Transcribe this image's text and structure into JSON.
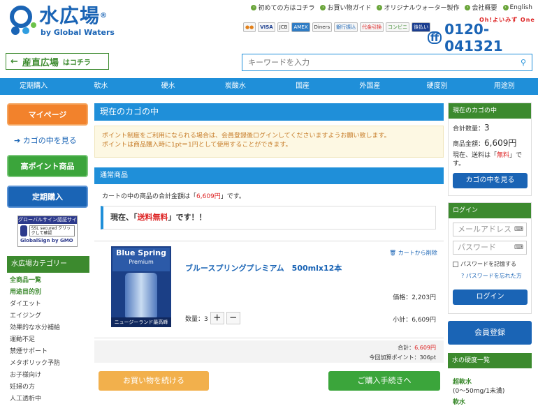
{
  "header": {
    "logo_text": "水広場",
    "logo_reg": "®",
    "logo_sub": "by Global Waters",
    "top_links": [
      "初めての方はコチラ",
      "お買い物ガイド",
      "オリジナルウォーター製作",
      "会社概要",
      "English"
    ],
    "pay_cards": [
      "●●",
      "VISA",
      "JCB",
      "AMEX",
      "Diners",
      "銀行振込",
      "代金引換",
      "コンビニ",
      "後払い"
    ],
    "phone_kana": "Oh!よいみず One",
    "phone_ff": "ff",
    "phone": "0120-041321",
    "sanchoku_main": "産直広場",
    "sanchoku_small": "はコチラ",
    "search_placeholder": "キーワードを入力",
    "search_icon": "🔍"
  },
  "nav": [
    "定期購入",
    "軟水",
    "硬水",
    "炭酸水",
    "国産",
    "外国産",
    "硬度別",
    "用途別"
  ],
  "left": {
    "mypage": "マイページ",
    "view_cart": "カゴの中を見る",
    "high_point": "高ポイント商品",
    "teiki": "定期購入",
    "gs_title": "グローバルサイン認証サイト",
    "gs_ssl": "SSL secured クリックして確認",
    "gs_brand": "GlobalSign by GMO",
    "category_head": "水広場カテゴリー",
    "categories": [
      "全商品一覧",
      "用途目的別",
      "ダイエット",
      "エイジング",
      "効果的な水分補給",
      "運動不足",
      "禁煙サポート",
      "メタボリック予防",
      "お子様向け",
      "妊婦の方",
      "人工透析中"
    ]
  },
  "main": {
    "title": "現在のカゴの中",
    "notice_1": "ポイント制度をご利用になられる場合は、会員登録後ログインしてくださいますようお願い致します。",
    "notice_2": "ポイントは商品購入時に1pt＝1円として使用することができます。",
    "section_head": "通常商品",
    "total_pre": "カートの中の商品の合計金額は「",
    "total_value": "6,609円",
    "total_post": "」です。",
    "ship_pre": "現在、「",
    "ship_value": "送料無料",
    "ship_post": "」です！！",
    "product_brand": "Blue Spring",
    "product_brand_sub": "Premium",
    "product_caption": "ニュージーランド最高峰",
    "remove": "カートから削除",
    "product_name": "ブルースプリングプレミアム　500mlx12本",
    "unit_price": "価格：2,203円",
    "qty_label": "数量：3",
    "plus": "＋",
    "minus": "－",
    "subtotal": "小計：6,609円",
    "sum_label": "合計：",
    "sum_value": "6,609円",
    "points": "今回加算ポイント：306pt",
    "continue": "お買い物を続ける",
    "checkout": "ご購入手続きへ"
  },
  "right": {
    "cart_head": "現在のカゴの中",
    "count_label": "合計数量：",
    "count_value": "3",
    "amount_label": "商品金額：",
    "amount_value": "6,609円",
    "ship_note_pre": "現在、送料は「",
    "ship_note_val": "無料",
    "ship_note_post": "」です。",
    "view_cart": "カゴの中を見る",
    "login_head": "ログイン",
    "email_placeholder": "メールアドレス",
    "password_placeholder": "パスワード",
    "remember": "パスワードを記憶する",
    "forgot": "パスワードを忘れた方",
    "login": "ログイン",
    "register": "会員登録",
    "hardness_head": "水の硬度一覧",
    "hard1": "超軟水",
    "hard1b": "(0〜50mg/1未満)",
    "hard2": "軟水"
  }
}
